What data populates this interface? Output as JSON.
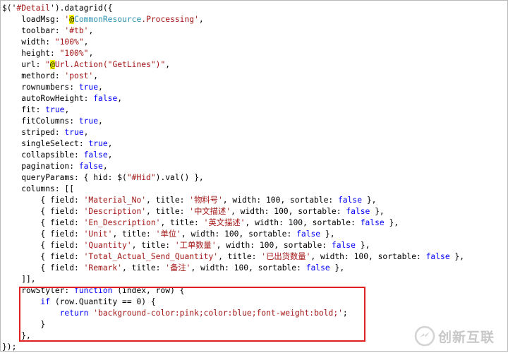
{
  "code_lines": [
    {
      "t": [
        [
          "$('",
          ""
        ],
        [
          "#Detail",
          "str"
        ],
        [
          "').datagrid({",
          ""
        ]
      ]
    },
    {
      "t": [
        [
          "    loadMsg: ",
          ""
        ],
        [
          "'",
          "str"
        ],
        [
          "@",
          "razor"
        ],
        [
          "CommonResource",
          "rname"
        ],
        [
          ".Processing'",
          "str"
        ],
        [
          ",",
          ""
        ]
      ]
    },
    {
      "t": [
        [
          "    toolbar: ",
          ""
        ],
        [
          "'#tb'",
          "str"
        ],
        [
          ",",
          ""
        ]
      ]
    },
    {
      "t": [
        [
          "    width: ",
          ""
        ],
        [
          "\"100%\"",
          "str"
        ],
        [
          ",",
          ""
        ]
      ]
    },
    {
      "t": [
        [
          "    height: ",
          ""
        ],
        [
          "\"100%\"",
          "str"
        ],
        [
          ",",
          ""
        ]
      ]
    },
    {
      "t": [
        [
          "    url: ",
          ""
        ],
        [
          "\"",
          "str"
        ],
        [
          "@",
          "razor"
        ],
        [
          "Url.Action(\"GetLines\")\"",
          "str"
        ],
        [
          ",",
          ""
        ]
      ]
    },
    {
      "t": [
        [
          "    methord: ",
          ""
        ],
        [
          "'post'",
          "str"
        ],
        [
          ",",
          ""
        ]
      ]
    },
    {
      "t": [
        [
          "    rownumbers: ",
          ""
        ],
        [
          "true",
          "kw"
        ],
        [
          ",",
          ""
        ]
      ]
    },
    {
      "t": [
        [
          "    autoRowHeight: ",
          ""
        ],
        [
          "false",
          "kw"
        ],
        [
          ",",
          ""
        ]
      ]
    },
    {
      "t": [
        [
          "    fit: ",
          ""
        ],
        [
          "true",
          "kw"
        ],
        [
          ",",
          ""
        ]
      ]
    },
    {
      "t": [
        [
          "    fitColumns: ",
          ""
        ],
        [
          "true",
          "kw"
        ],
        [
          ",",
          ""
        ]
      ]
    },
    {
      "t": [
        [
          "    striped: ",
          ""
        ],
        [
          "true",
          "kw"
        ],
        [
          ",",
          ""
        ]
      ]
    },
    {
      "t": [
        [
          "    singleSelect: ",
          ""
        ],
        [
          "true",
          "kw"
        ],
        [
          ",",
          ""
        ]
      ]
    },
    {
      "t": [
        [
          "    collapsible: ",
          ""
        ],
        [
          "false",
          "kw"
        ],
        [
          ",",
          ""
        ]
      ]
    },
    {
      "t": [
        [
          "    pagination: ",
          ""
        ],
        [
          "false",
          "kw"
        ],
        [
          ",",
          ""
        ]
      ]
    },
    {
      "t": [
        [
          "    queryParams: { hid: $(",
          ""
        ],
        [
          "\"#Hid\"",
          "str"
        ],
        [
          ").val() },",
          ""
        ]
      ]
    },
    {
      "t": [
        [
          "    columns: [[",
          ""
        ]
      ]
    },
    {
      "t": [
        [
          "        { field: ",
          ""
        ],
        [
          "'Material_No'",
          "str"
        ],
        [
          ", title: ",
          ""
        ],
        [
          "'物料号'",
          "str"
        ],
        [
          ", width: 100, sortable: ",
          ""
        ],
        [
          "false",
          "kw"
        ],
        [
          " },",
          ""
        ]
      ]
    },
    {
      "t": [
        [
          "        { field: ",
          ""
        ],
        [
          "'Description'",
          "str"
        ],
        [
          ", title: ",
          ""
        ],
        [
          "'中文描述'",
          "str"
        ],
        [
          ", width: 100, sortable: ",
          ""
        ],
        [
          "false",
          "kw"
        ],
        [
          " },",
          ""
        ]
      ]
    },
    {
      "t": [
        [
          "        { field: ",
          ""
        ],
        [
          "'En_Description'",
          "str"
        ],
        [
          ", title: ",
          ""
        ],
        [
          "'英文描述'",
          "str"
        ],
        [
          ", width: 100, sortable: ",
          ""
        ],
        [
          "false",
          "kw"
        ],
        [
          " },",
          ""
        ]
      ]
    },
    {
      "t": [
        [
          "        { field: ",
          ""
        ],
        [
          "'Unit'",
          "str"
        ],
        [
          ", title: ",
          ""
        ],
        [
          "'单位'",
          "str"
        ],
        [
          ", width: 100, sortable: ",
          ""
        ],
        [
          "false",
          "kw"
        ],
        [
          " },",
          ""
        ]
      ]
    },
    {
      "t": [
        [
          "        { field: ",
          ""
        ],
        [
          "'Quantity'",
          "str"
        ],
        [
          ", title: ",
          ""
        ],
        [
          "'工单数量'",
          "str"
        ],
        [
          ", width: 100, sortable: ",
          ""
        ],
        [
          "false",
          "kw"
        ],
        [
          " },",
          ""
        ]
      ]
    },
    {
      "t": [
        [
          "        { field: ",
          ""
        ],
        [
          "'Total_Actual_Send_Quantity'",
          "str"
        ],
        [
          ", title: ",
          ""
        ],
        [
          "'已出货数量'",
          "str"
        ],
        [
          ", width: 100, sortable: ",
          ""
        ],
        [
          "false",
          "kw"
        ],
        [
          " },",
          ""
        ]
      ]
    },
    {
      "t": [
        [
          "        { field: ",
          ""
        ],
        [
          "'Remark'",
          "str"
        ],
        [
          ", title: ",
          ""
        ],
        [
          "'备注'",
          "str"
        ],
        [
          ", width: 100, sortable: ",
          ""
        ],
        [
          "false",
          "kw"
        ],
        [
          " },",
          ""
        ]
      ]
    },
    {
      "t": [
        [
          "    ]],",
          ""
        ]
      ]
    },
    {
      "t": [
        [
          "    rowStyler: ",
          ""
        ],
        [
          "function",
          "kw"
        ],
        [
          " (index, row) {",
          ""
        ]
      ]
    },
    {
      "t": [
        [
          "        ",
          ""
        ],
        [
          "if",
          "kw"
        ],
        [
          " (row.Quantity == 0) {",
          ""
        ]
      ]
    },
    {
      "t": [
        [
          "            ",
          ""
        ],
        [
          "return",
          "kw"
        ],
        [
          " ",
          ""
        ],
        [
          "'background-color:pink;color:blue;font-weight:bold;'",
          "str"
        ],
        [
          ";",
          ""
        ]
      ]
    },
    {
      "t": [
        [
          "        }",
          ""
        ]
      ]
    },
    {
      "t": [
        [
          "    },",
          ""
        ]
      ]
    },
    {
      "t": [
        [
          "});",
          ""
        ]
      ]
    }
  ],
  "watermark": {
    "text": "创新互联",
    "color": "#9a9a9a",
    "icon": "chuangxin-logo-icon"
  },
  "colors": {
    "string": "#a31515",
    "keyword": "#0000ff",
    "razor_bg": "#ffff00",
    "highlight_box": "#e02020"
  }
}
